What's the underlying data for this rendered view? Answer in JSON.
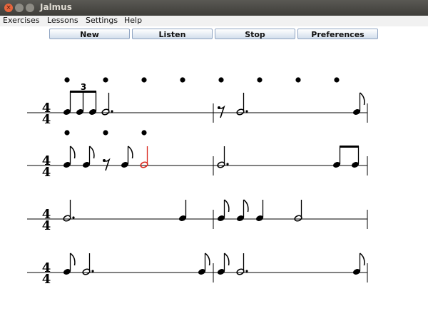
{
  "window": {
    "title": "Jalmus"
  },
  "menu": {
    "items": [
      "Exercises",
      "Lessons",
      "Settings",
      "Help"
    ]
  },
  "toolbar": {
    "new_label": "New",
    "listen_label": "Listen",
    "stop_label": "Stop",
    "preferences_label": "Preferences"
  },
  "score": {
    "time_signature_top": "4",
    "time_signature_bottom": "4",
    "triplet_label": "3",
    "highlight_color": "#d9261c"
  }
}
